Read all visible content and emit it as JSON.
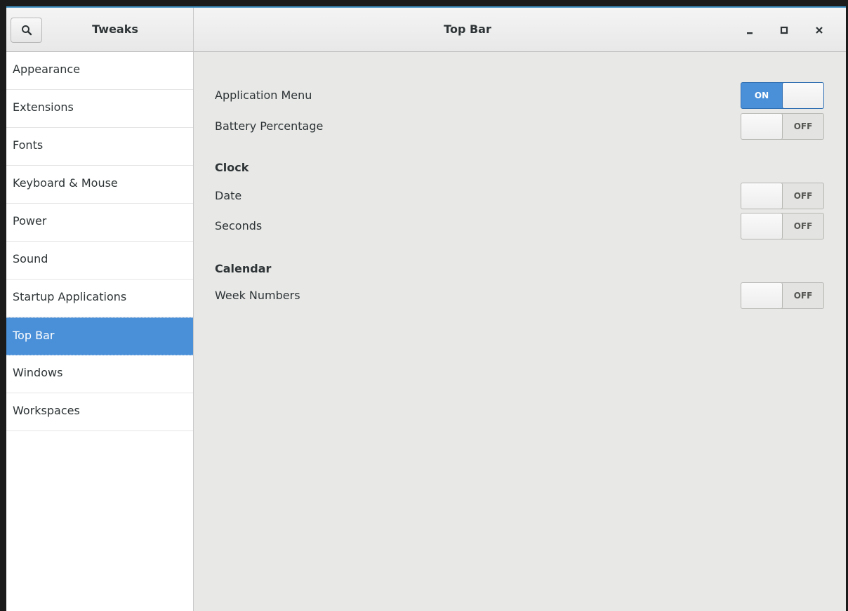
{
  "window": {
    "accent_color": "#4a90d9",
    "title_border_color": "#3d8ec1"
  },
  "header": {
    "search_icon": "search-icon",
    "app_title": "Tweaks",
    "page_title": "Top Bar",
    "controls": {
      "minimize_icon": "minimize-icon",
      "maximize_icon": "maximize-icon",
      "close_icon": "close-icon"
    }
  },
  "sidebar": {
    "selected": "Top Bar",
    "items": [
      {
        "label": "Appearance"
      },
      {
        "label": "Extensions"
      },
      {
        "label": "Fonts"
      },
      {
        "label": "Keyboard & Mouse"
      },
      {
        "label": "Power"
      },
      {
        "label": "Sound"
      },
      {
        "label": "Startup Applications"
      },
      {
        "label": "Top Bar"
      },
      {
        "label": "Windows"
      },
      {
        "label": "Workspaces"
      }
    ]
  },
  "content": {
    "settings": [
      {
        "label": "Application Menu",
        "state": "ON"
      },
      {
        "label": "Battery Percentage",
        "state": "OFF"
      }
    ],
    "clock": {
      "heading": "Clock",
      "settings": [
        {
          "label": "Date",
          "state": "OFF"
        },
        {
          "label": "Seconds",
          "state": "OFF"
        }
      ]
    },
    "calendar": {
      "heading": "Calendar",
      "settings": [
        {
          "label": "Week Numbers",
          "state": "OFF"
        }
      ]
    }
  }
}
